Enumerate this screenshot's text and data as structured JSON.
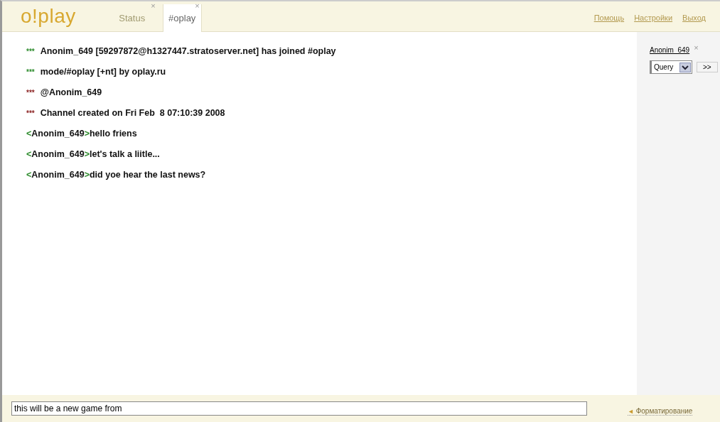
{
  "logo": "o!play",
  "tabs": [
    {
      "label": "Status",
      "close": "×",
      "selected": false
    },
    {
      "label": "#oplay",
      "close": "×",
      "selected": true
    }
  ],
  "header_links": [
    "Помощь",
    "Настройки",
    "Выход"
  ],
  "messages": [
    {
      "kind": "system",
      "marker": "***",
      "color": "#2a8a2a",
      "text": "Anonim_649 [59297872@h1327447.stratoserver.net] has joined #oplay"
    },
    {
      "kind": "system",
      "marker": "***",
      "color": "#2a8a2a",
      "text": "mode/#oplay [+nt] by oplay.ru"
    },
    {
      "kind": "system",
      "marker": "***",
      "color": "#8a2020",
      "text": "@Anonim_649"
    },
    {
      "kind": "system",
      "marker": "***",
      "color": "#8a2020",
      "text": "Channel created on Fri Feb  8 07:10:39 2008"
    },
    {
      "kind": "chat",
      "open": "<",
      "nick": "Anonim_649",
      "close": ">",
      "text": "hello friens"
    },
    {
      "kind": "chat",
      "open": "<",
      "nick": "Anonim_649",
      "close": ">",
      "text": "let's talk a liitle..."
    },
    {
      "kind": "chat",
      "open": "<",
      "nick": "Anonim_649",
      "close": ">",
      "text": "did yoe hear the last news?"
    }
  ],
  "users": [
    {
      "name": "Anonim_649",
      "close": "×"
    }
  ],
  "user_action": {
    "value": "Query",
    "button": ">>"
  },
  "input": {
    "value": "this will be a new game from "
  },
  "format_link": {
    "arrow": "◄",
    "label": "Форматирование"
  }
}
